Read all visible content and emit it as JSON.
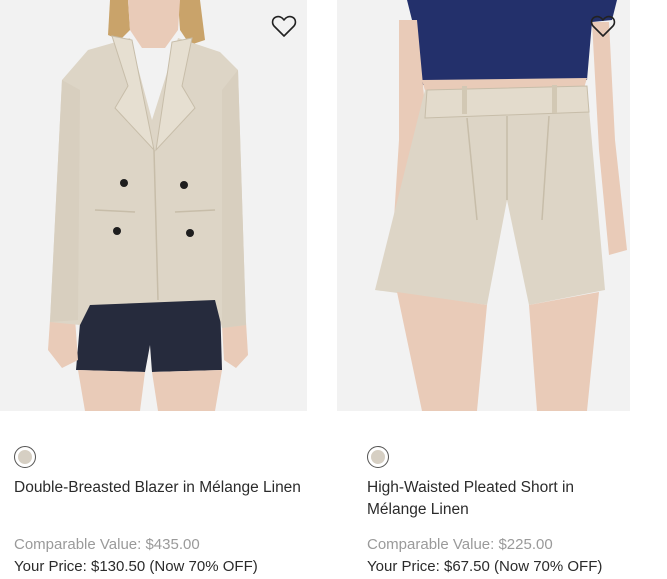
{
  "products": [
    {
      "name": "Double-Breasted Blazer in Mélange Linen",
      "comparable_value": "Comparable Value: $435.00",
      "your_price": "Your Price: $130.50 (Now 70% OFF)",
      "swatch_color": "#d6cfc3",
      "wishlist_icon": "heart-outline-icon",
      "image_alt": "Double-breasted beige linen blazer worn with navy shorts"
    },
    {
      "name": "High-Waisted Pleated Short in Mélange Linen",
      "comparable_value": "Comparable Value: $225.00",
      "your_price": "Your Price: $67.50 (Now 70% OFF)",
      "swatch_color": "#d6cfc3",
      "wishlist_icon": "heart-outline-icon",
      "image_alt": "Beige linen high-waisted pleated shorts worn with navy top"
    }
  ],
  "colors": {
    "image_bg": "#f2f2f2",
    "comparable_text": "#9a9a9a",
    "text": "#2b2b2b",
    "blazer": "#ddd5c6",
    "shorts_navy": "#262b3d",
    "top_navy": "#23306b",
    "skin": "#e9cbb8"
  }
}
